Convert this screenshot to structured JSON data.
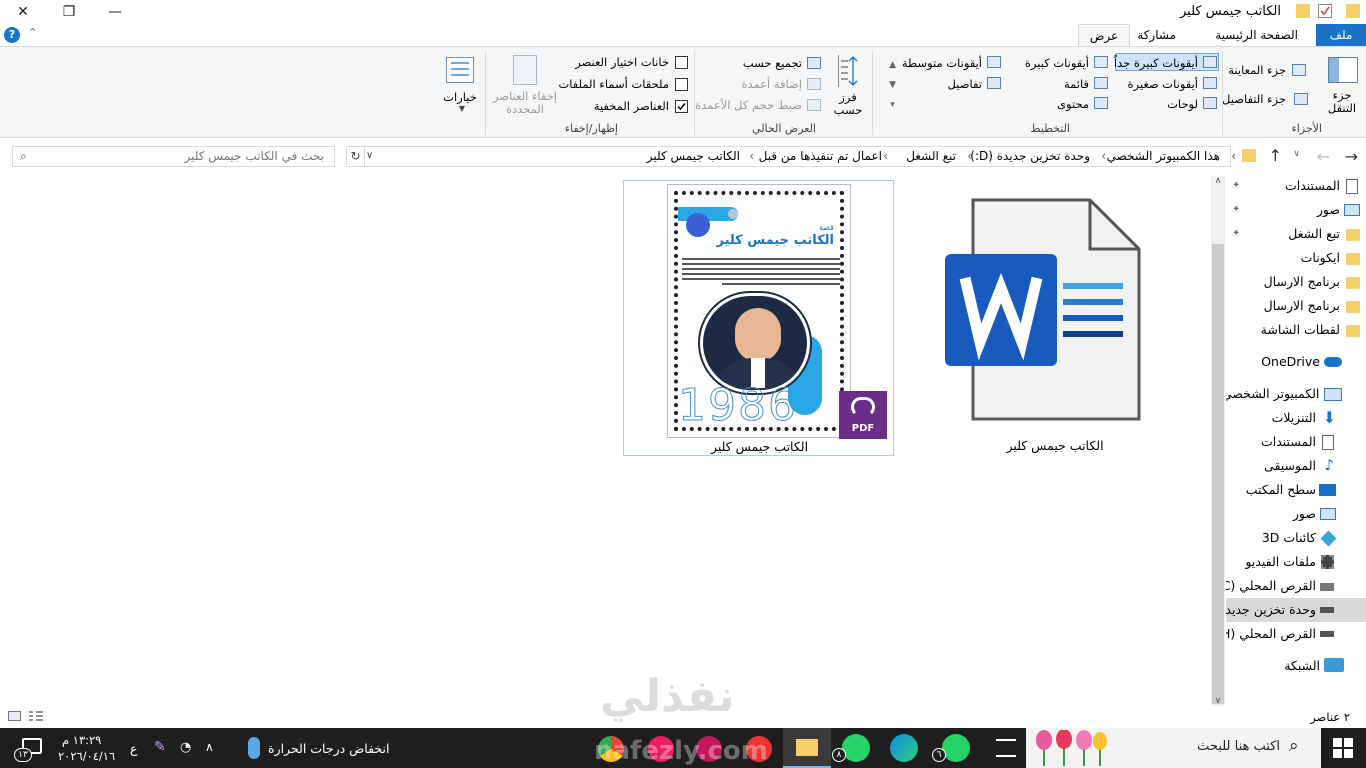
{
  "window": {
    "title": "الكاتب جيمس كلير",
    "minimize_glyph": "—",
    "maximize_glyph": "❐",
    "close_glyph": "✕"
  },
  "tabs": [
    {
      "label": "ملف"
    },
    {
      "label": "الصفحة الرئيسية"
    },
    {
      "label": "مشاركة"
    },
    {
      "label": "عرض"
    }
  ],
  "ribbon": {
    "panes": {
      "label": "الأجزاء",
      "nav_pane": "جزء التنقل",
      "preview_pane": "جزء المعاينة",
      "details_pane": "جزء التفاصيل"
    },
    "layout": {
      "label": "التخطيط",
      "items": [
        {
          "label": "أيقونات كبيرة جداً"
        },
        {
          "label": "أيقونات كبيرة"
        },
        {
          "label": "أيقونات متوسطة"
        },
        {
          "label": "أيقونات صغيرة"
        },
        {
          "label": "قائمة"
        },
        {
          "label": "تفاصيل"
        },
        {
          "label": "لوحات"
        },
        {
          "label": "محتوى"
        }
      ]
    },
    "current_view": {
      "label": "العرض الحالي",
      "sort_by": "فرز حسب",
      "group_by": "تجميع حسب",
      "add_columns": "إضافة أعمدة",
      "size_columns": "ضبط حجم كل الأعمدة"
    },
    "show_hide": {
      "label": "إظهار/إخفاء",
      "item_checkboxes": "خانات اختيار العنصر",
      "file_extensions": "ملحقات أسماء الملفات",
      "hidden_items": "العناصر المخفية",
      "hide_selected": "إخفاء العناصر المحددة"
    },
    "options": "خيارات"
  },
  "address": {
    "crumbs": [
      "هذا الكمبيوتر الشخصي",
      "وحدة تخزين جديدة (D:)",
      "تبع الشغل",
      "اعمال تم تنفيذها من قبل",
      "الكاتب جيمس كلير"
    ],
    "search_placeholder": "بحث في الكاتب جيمس كلير"
  },
  "nav": {
    "quick": [
      {
        "label": "المستندات",
        "icon": "documents-icon"
      },
      {
        "label": "صور",
        "icon": "pictures-icon"
      },
      {
        "label": "تبع الشغل",
        "icon": "folder-icon"
      },
      {
        "label": "ايكونات",
        "icon": "folder-icon"
      },
      {
        "label": "برنامج الارسال",
        "icon": "folder-icon"
      },
      {
        "label": "برنامج الارسال",
        "icon": "folder-icon"
      },
      {
        "label": "لقطات الشاشة",
        "icon": "folder-icon"
      }
    ],
    "onedrive": "OneDrive",
    "this_pc": "هذا الكمبيوتر الشخصي",
    "pc_items": [
      {
        "label": "التنزيلات",
        "icon": "downloads-icon"
      },
      {
        "label": "المستندات",
        "icon": "documents-icon"
      },
      {
        "label": "الموسيقى",
        "icon": "music-icon"
      },
      {
        "label": "سطح المكتب",
        "icon": "desktop-icon"
      },
      {
        "label": "صور",
        "icon": "pictures-icon"
      },
      {
        "label": "كائنات 3D",
        "icon": "3d-objects-icon"
      },
      {
        "label": "ملفات الفيديو",
        "icon": "videos-icon"
      },
      {
        "label": "القرص المحلي (C:)",
        "icon": "drive-icon"
      },
      {
        "label": "وحدة تخزين جديدة (D:)",
        "icon": "drive-icon"
      },
      {
        "label": "القرص المحلي (H:)",
        "icon": "drive-icon"
      }
    ],
    "network": "الشبكة"
  },
  "files": [
    {
      "name": "الكاتب جيمس كلير",
      "type": "word-document"
    },
    {
      "name": "الكاتب جيمس كلير",
      "type": "pdf-document"
    }
  ],
  "pdf_preview": {
    "kicker": "قصة",
    "title": "الكاتب جيمس كلير",
    "year": "1986",
    "badge": "PDF"
  },
  "status": {
    "count": "٢ عناصر"
  },
  "taskbar": {
    "search_placeholder": "اكتب هنا للبحث",
    "weather": "انخفاض درجات الحرارة",
    "time": "١٣:٢٩ م",
    "date": "٢٠٢٦/٠٤/١٦",
    "lang": "ع",
    "notif_count": "١٣",
    "badge_a": "٨",
    "badge_b": "٦"
  },
  "watermark": {
    "arabic": "نفذلي",
    "latin": "nafezly.com"
  },
  "colors": {
    "accent": "#1a73c9",
    "folder": "#f4cf6a",
    "word_blue": "#185abd",
    "pdf_purple": "#6b2d8a",
    "taskbar": "#1e1e1e"
  }
}
